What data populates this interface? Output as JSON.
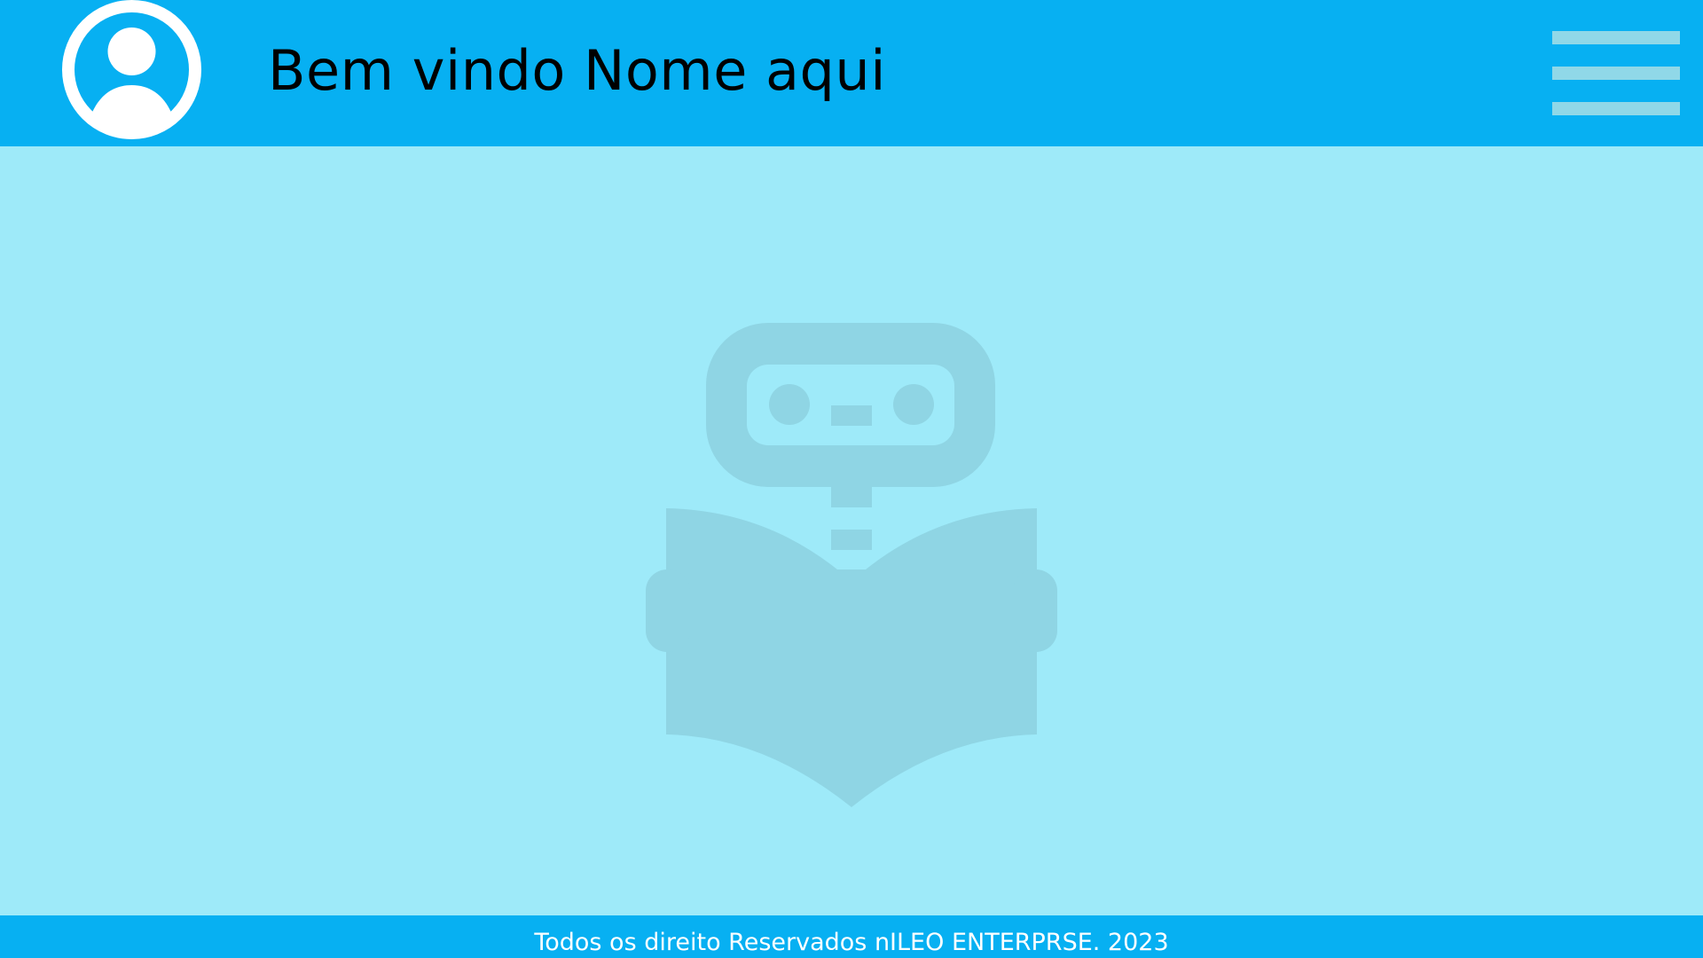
{
  "header": {
    "welcome_text": "Bem vindo Nome aqui",
    "avatar_icon": "user-avatar-icon",
    "menu_icon": "hamburger-menu-icon"
  },
  "main": {
    "illustration_icon": "robot-reading-book-icon"
  },
  "footer": {
    "copyright_text": "Todos os direito Reservados nILEO ENTERPRSE. 2023"
  },
  "colors": {
    "header_background": "#07b0f2",
    "main_background": "#9eeaf9",
    "footer_background": "#07b0f2",
    "illustration": "#8fd5e4",
    "menu_bars": "#90d8e8",
    "welcome_text": "#000000",
    "footer_text": "#ffffff",
    "avatar": "#ffffff"
  }
}
